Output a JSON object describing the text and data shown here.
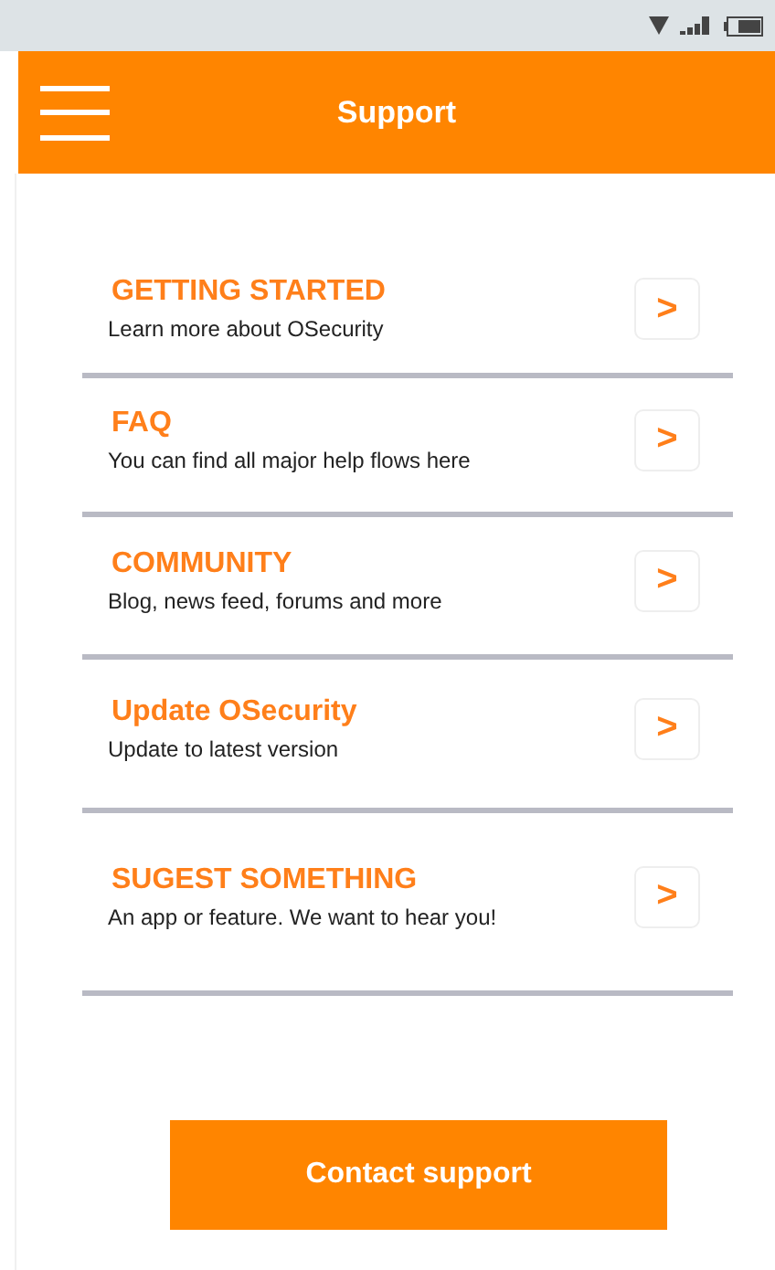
{
  "header": {
    "title": "Support"
  },
  "items": [
    {
      "title": "GETTING STARTED",
      "subtitle": "Learn more about OSecurity",
      "arrow": ">"
    },
    {
      "title": "FAQ",
      "subtitle": "You can find all major help flows here",
      "arrow": ">"
    },
    {
      "title": "COMMUNITY",
      "subtitle": "Blog, news feed, forums and more",
      "arrow": ">"
    },
    {
      "title": "Update OSecurity",
      "subtitle": "Update to latest version",
      "arrow": ">"
    },
    {
      "title": "SUGEST SOMETHING",
      "subtitle": "An app or feature. We want to hear you!",
      "arrow": ">"
    }
  ],
  "contact_button": {
    "label": "Contact support"
  }
}
